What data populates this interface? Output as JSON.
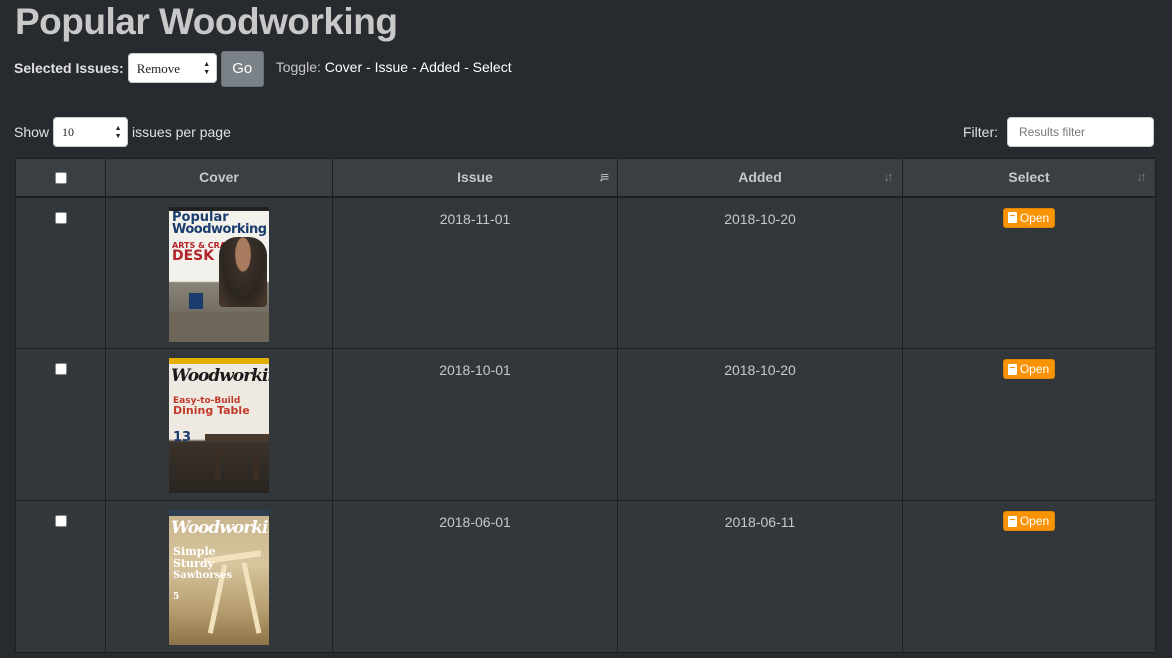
{
  "page": {
    "title": "Popular Woodworking"
  },
  "bulk": {
    "label": "Selected Issues:",
    "action_value": "Remove",
    "go_label": "Go",
    "toggle_label": "Toggle:",
    "toggle_links": [
      "Cover",
      "Issue",
      "Added",
      "Select"
    ],
    "toggle_sep": " - "
  },
  "paging": {
    "show_label": "Show",
    "page_size": "10",
    "suffix": "issues per page"
  },
  "filter": {
    "label": "Filter:",
    "placeholder": "Results filter"
  },
  "table": {
    "columns": [
      "Cover",
      "Issue",
      "Added",
      "Select"
    ],
    "sorted_column": "Issue",
    "rows": [
      {
        "issue": "2018-11-01",
        "added": "2018-10-20",
        "action": "Open",
        "cover": {
          "logo_line1": "Popular",
          "logo_line2": "Woodworking",
          "headline1": "ARTS & CRAFTS",
          "headline2": "DESK"
        }
      },
      {
        "issue": "2018-10-01",
        "added": "2018-10-20",
        "action": "Open",
        "cover": {
          "logo": "Woodworking",
          "headline1": "Easy-to-Build",
          "headline2": "Dining Table",
          "number": "13"
        }
      },
      {
        "issue": "2018-06-01",
        "added": "2018-06-11",
        "action": "Open",
        "cover": {
          "logo": "Woodworking",
          "headline1": "Simple",
          "headline2": "Sturdy",
          "headline3": "Sawhorses",
          "number": "5"
        }
      }
    ]
  },
  "colors": {
    "background": "#272b30",
    "header_bg": "#3a3f44",
    "row_bg": "#32373c",
    "open_button": "#f89406",
    "go_button": "#7a8288"
  },
  "icons": {
    "open": "book-icon",
    "sort_desc": "sort-desc-icon",
    "sort_both": "sort-both-icon"
  }
}
